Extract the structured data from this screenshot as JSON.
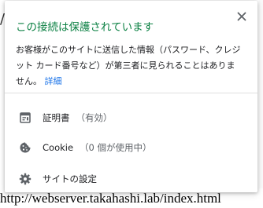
{
  "background": {
    "slash": "/",
    "url_fragment": "http://webserver.takahashi.lab/index.html"
  },
  "popup": {
    "title": "この接続は保護されています",
    "description": "お客様がこのサイトに送信した情報（パスワード、クレジット カード番号など）が第三者に見られることはありません。",
    "details_link": "詳細",
    "close_icon": "close-icon",
    "rows": [
      {
        "icon": "certificate-icon",
        "label": "証明書",
        "sub": "（有効）"
      },
      {
        "icon": "cookie-icon",
        "label": "Cookie",
        "sub": "（0 個が使用中）"
      },
      {
        "icon": "gear-icon",
        "label": "サイトの設定",
        "sub": ""
      }
    ]
  },
  "colors": {
    "secure_green": "#0b8043",
    "link_blue": "#1a73e8",
    "icon_gray": "#5f6368"
  }
}
